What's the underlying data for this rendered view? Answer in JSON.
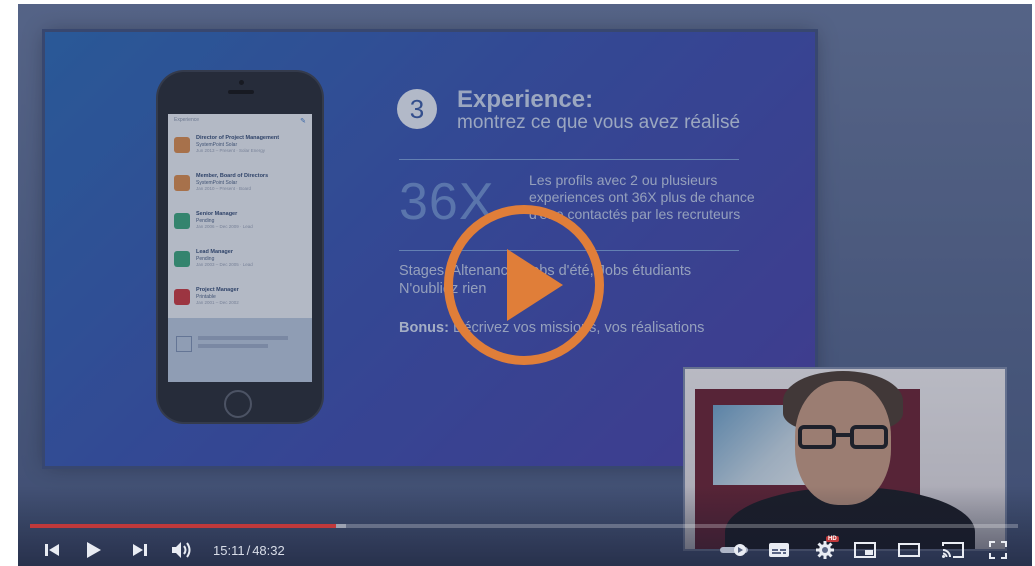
{
  "slide": {
    "step_number": "3",
    "title": "Experience:",
    "subtitle": "montrez ce que vous avez réalisé",
    "stat_value": "36X",
    "stat_text": "Les profils avec 2 ou plusieurs experiences ont 36X plus de chance d'être contactés par les recruteurs",
    "line1": "Stages, Altenance, Jobs d'été, Jobs étudiants",
    "line2": "N'oubliez rien",
    "bonus_label": "Bonus:",
    "bonus_text": " Décrivez vos missions, vos réalisations"
  },
  "phone": {
    "section_label": "Experience",
    "entries": [
      {
        "title": "Director of Project Management",
        "company": "SystemPoint Solar",
        "meta": "Jun 2013 – Present · Solar Energy",
        "logo_color": "#d98a4a"
      },
      {
        "title": "Member, Board of Directors",
        "company": "SystemPoint Solar",
        "meta": "Jan 2010 – Present · Board",
        "logo_color": "#d98a4a"
      },
      {
        "title": "Senior Manager",
        "company": "Pending",
        "meta": "Jan 2006 – Dec 2009 · Lead",
        "logo_color": "#3aa47a"
      },
      {
        "title": "Lead Manager",
        "company": "Pending",
        "meta": "Jan 2003 – Dec 2005 · Lead",
        "logo_color": "#3aa47a"
      },
      {
        "title": "Project Manager",
        "company": "Printable",
        "meta": "Jan 2001 – Dec 2002",
        "logo_color": "#c9363c"
      }
    ]
  },
  "player": {
    "current_time": "15:11",
    "separator": "/",
    "duration": "48:32",
    "progress_fraction": 0.31,
    "loaded_fraction": 0.32,
    "hd_badge": "HD",
    "accent_color": "#e07e39",
    "progress_color": "#c0393b"
  },
  "icons": [
    "previous-icon",
    "play-icon",
    "next-icon",
    "volume-icon",
    "autoplay-toggle-icon",
    "subtitles-icon",
    "settings-icon",
    "miniplayer-icon",
    "theater-icon",
    "cast-icon",
    "fullscreen-icon"
  ]
}
